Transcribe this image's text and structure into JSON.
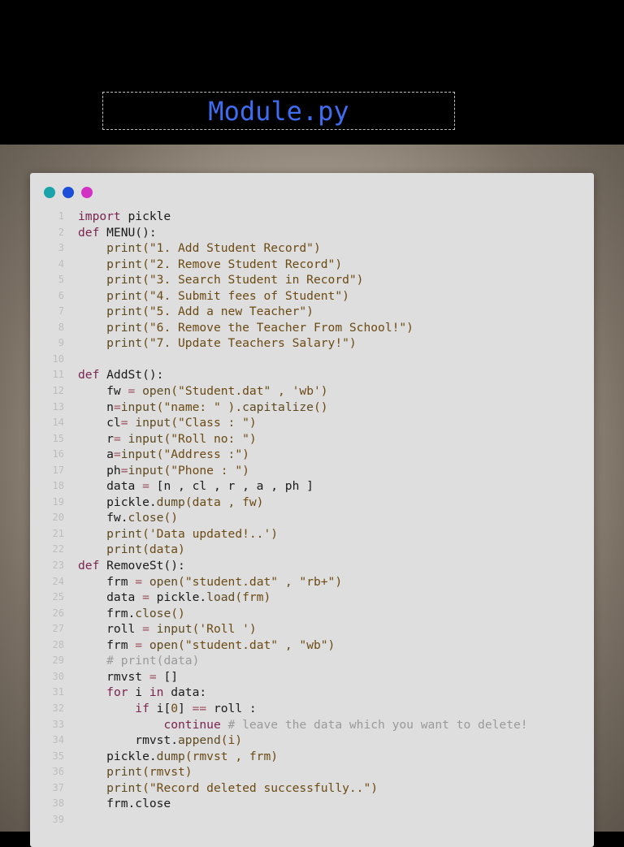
{
  "title": "Module.py",
  "colors": {
    "background": "#000000",
    "title": "#3f6df2",
    "window": "#dedede",
    "dot_1": "#1aa3a8",
    "dot_2": "#1c4fd8",
    "dot_3": "#d231c4"
  },
  "window_dots": [
    {
      "name": "teal-dot",
      "color": "#1aa3a8"
    },
    {
      "name": "blue-dot",
      "color": "#1c4fd8"
    },
    {
      "name": "magenta-dot",
      "color": "#d231c4"
    }
  ],
  "code_lines": [
    {
      "n": "1",
      "tokens": [
        [
          "kw",
          "import"
        ],
        [
          "pl",
          " pickle"
        ]
      ]
    },
    {
      "n": "2",
      "tokens": [
        [
          "kw",
          "def"
        ],
        [
          "pl",
          " MENU():"
        ]
      ]
    },
    {
      "n": "3",
      "tokens": [
        [
          "pl",
          "    "
        ],
        [
          "fn",
          "print"
        ],
        [
          "str",
          "(\"1. Add Student Record\")"
        ]
      ]
    },
    {
      "n": "4",
      "tokens": [
        [
          "pl",
          "    "
        ],
        [
          "fn",
          "print"
        ],
        [
          "str",
          "(\"2. Remove Student Record\")"
        ]
      ]
    },
    {
      "n": "5",
      "tokens": [
        [
          "pl",
          "    "
        ],
        [
          "fn",
          "print"
        ],
        [
          "str",
          "(\"3. Search Student in Record\")"
        ]
      ]
    },
    {
      "n": "6",
      "tokens": [
        [
          "pl",
          "    "
        ],
        [
          "fn",
          "print"
        ],
        [
          "str",
          "(\"4. Submit fees of Student\")"
        ]
      ]
    },
    {
      "n": "7",
      "tokens": [
        [
          "pl",
          "    "
        ],
        [
          "fn",
          "print"
        ],
        [
          "str",
          "(\"5. Add a new Teacher\")"
        ]
      ]
    },
    {
      "n": "8",
      "tokens": [
        [
          "pl",
          "    "
        ],
        [
          "fn",
          "print"
        ],
        [
          "str",
          "(\"6. Remove the Teacher From School!\")"
        ]
      ]
    },
    {
      "n": "9",
      "tokens": [
        [
          "pl",
          "    "
        ],
        [
          "fn",
          "print"
        ],
        [
          "str",
          "(\"7. Update Teachers Salary!\")"
        ]
      ]
    },
    {
      "n": "10",
      "tokens": []
    },
    {
      "n": "11",
      "tokens": [
        [
          "kw",
          "def"
        ],
        [
          "pl",
          " AddSt():"
        ]
      ]
    },
    {
      "n": "12",
      "tokens": [
        [
          "pl",
          "    fw "
        ],
        [
          "op",
          "="
        ],
        [
          "pl",
          " "
        ],
        [
          "fn",
          "open"
        ],
        [
          "str",
          "(\"Student.dat\" , 'wb')"
        ]
      ]
    },
    {
      "n": "13",
      "tokens": [
        [
          "pl",
          "    n"
        ],
        [
          "op",
          "="
        ],
        [
          "fn",
          "input"
        ],
        [
          "str",
          "(\"name: \" )."
        ],
        [
          "fn",
          "capitalize"
        ],
        [
          "str",
          "()"
        ]
      ]
    },
    {
      "n": "14",
      "tokens": [
        [
          "pl",
          "    cl"
        ],
        [
          "op",
          "="
        ],
        [
          "pl",
          " "
        ],
        [
          "fn",
          "input"
        ],
        [
          "str",
          "(\"Class : \")"
        ]
      ]
    },
    {
      "n": "15",
      "tokens": [
        [
          "pl",
          "    r"
        ],
        [
          "op",
          "="
        ],
        [
          "pl",
          " "
        ],
        [
          "fn",
          "input"
        ],
        [
          "str",
          "(\"Roll no: \")"
        ]
      ]
    },
    {
      "n": "16",
      "tokens": [
        [
          "pl",
          "    a"
        ],
        [
          "op",
          "="
        ],
        [
          "fn",
          "input"
        ],
        [
          "str",
          "(\"Address :\")"
        ]
      ]
    },
    {
      "n": "17",
      "tokens": [
        [
          "pl",
          "    ph"
        ],
        [
          "op",
          "="
        ],
        [
          "fn",
          "input"
        ],
        [
          "str",
          "(\"Phone : \")"
        ]
      ]
    },
    {
      "n": "18",
      "tokens": [
        [
          "pl",
          "    data "
        ],
        [
          "op",
          "="
        ],
        [
          "pl",
          " [n , cl , r , a , ph ]"
        ]
      ]
    },
    {
      "n": "19",
      "tokens": [
        [
          "pl",
          "    pickle."
        ],
        [
          "fn",
          "dump"
        ],
        [
          "str",
          "(data , fw)"
        ]
      ]
    },
    {
      "n": "20",
      "tokens": [
        [
          "pl",
          "    fw."
        ],
        [
          "fn",
          "close"
        ],
        [
          "str",
          "()"
        ]
      ]
    },
    {
      "n": "21",
      "tokens": [
        [
          "pl",
          "    "
        ],
        [
          "fn",
          "print"
        ],
        [
          "str",
          "('Data updated!..')"
        ]
      ]
    },
    {
      "n": "22",
      "tokens": [
        [
          "pl",
          "    "
        ],
        [
          "fn",
          "print"
        ],
        [
          "str",
          "(data)"
        ]
      ]
    },
    {
      "n": "23",
      "tokens": [
        [
          "kw",
          "def"
        ],
        [
          "pl",
          " RemoveSt():"
        ]
      ]
    },
    {
      "n": "24",
      "tokens": [
        [
          "pl",
          "    frm "
        ],
        [
          "op",
          "="
        ],
        [
          "pl",
          " "
        ],
        [
          "fn",
          "open"
        ],
        [
          "str",
          "(\"student.dat\" , \"rb+\")"
        ]
      ]
    },
    {
      "n": "25",
      "tokens": [
        [
          "pl",
          "    data "
        ],
        [
          "op",
          "="
        ],
        [
          "pl",
          " pickle."
        ],
        [
          "fn",
          "load"
        ],
        [
          "str",
          "(frm)"
        ]
      ]
    },
    {
      "n": "26",
      "tokens": [
        [
          "pl",
          "    frm."
        ],
        [
          "fn",
          "close"
        ],
        [
          "str",
          "()"
        ]
      ]
    },
    {
      "n": "27",
      "tokens": [
        [
          "pl",
          "    roll "
        ],
        [
          "op",
          "="
        ],
        [
          "pl",
          " "
        ],
        [
          "fn",
          "input"
        ],
        [
          "str",
          "('Roll ')"
        ]
      ]
    },
    {
      "n": "28",
      "tokens": [
        [
          "pl",
          "    frm "
        ],
        [
          "op",
          "="
        ],
        [
          "pl",
          " "
        ],
        [
          "fn",
          "open"
        ],
        [
          "str",
          "(\"student.dat\" , \"wb\")"
        ]
      ]
    },
    {
      "n": "29",
      "tokens": [
        [
          "pl",
          "    "
        ],
        [
          "cm",
          "# print(data)"
        ]
      ]
    },
    {
      "n": "30",
      "tokens": [
        [
          "pl",
          "    rmvst "
        ],
        [
          "op",
          "="
        ],
        [
          "pl",
          " []"
        ]
      ]
    },
    {
      "n": "31",
      "tokens": [
        [
          "pl",
          "    "
        ],
        [
          "kw",
          "for"
        ],
        [
          "pl",
          " i "
        ],
        [
          "kw",
          "in"
        ],
        [
          "pl",
          " data:"
        ]
      ]
    },
    {
      "n": "32",
      "tokens": [
        [
          "pl",
          "        "
        ],
        [
          "kw",
          "if"
        ],
        [
          "pl",
          " i["
        ],
        [
          "num",
          "0"
        ],
        [
          "pl",
          "] "
        ],
        [
          "op",
          "=="
        ],
        [
          "pl",
          " roll :"
        ]
      ]
    },
    {
      "n": "33",
      "tokens": [
        [
          "pl",
          "            "
        ],
        [
          "kw",
          "continue"
        ],
        [
          "pl",
          " "
        ],
        [
          "cm",
          "# leave the data which you want to delete!"
        ]
      ]
    },
    {
      "n": "34",
      "tokens": [
        [
          "pl",
          "        rmvst."
        ],
        [
          "fn",
          "append"
        ],
        [
          "str",
          "(i)"
        ]
      ]
    },
    {
      "n": "35",
      "tokens": [
        [
          "pl",
          "    pickle."
        ],
        [
          "fn",
          "dump"
        ],
        [
          "str",
          "(rmvst , frm)"
        ]
      ]
    },
    {
      "n": "36",
      "tokens": [
        [
          "pl",
          "    "
        ],
        [
          "fn",
          "print"
        ],
        [
          "str",
          "(rmvst)"
        ]
      ]
    },
    {
      "n": "37",
      "tokens": [
        [
          "pl",
          "    "
        ],
        [
          "fn",
          "print"
        ],
        [
          "str",
          "(\"Record deleted successfully..\")"
        ]
      ]
    },
    {
      "n": "38",
      "tokens": [
        [
          "pl",
          "    frm.close"
        ]
      ]
    },
    {
      "n": "39",
      "tokens": []
    }
  ]
}
